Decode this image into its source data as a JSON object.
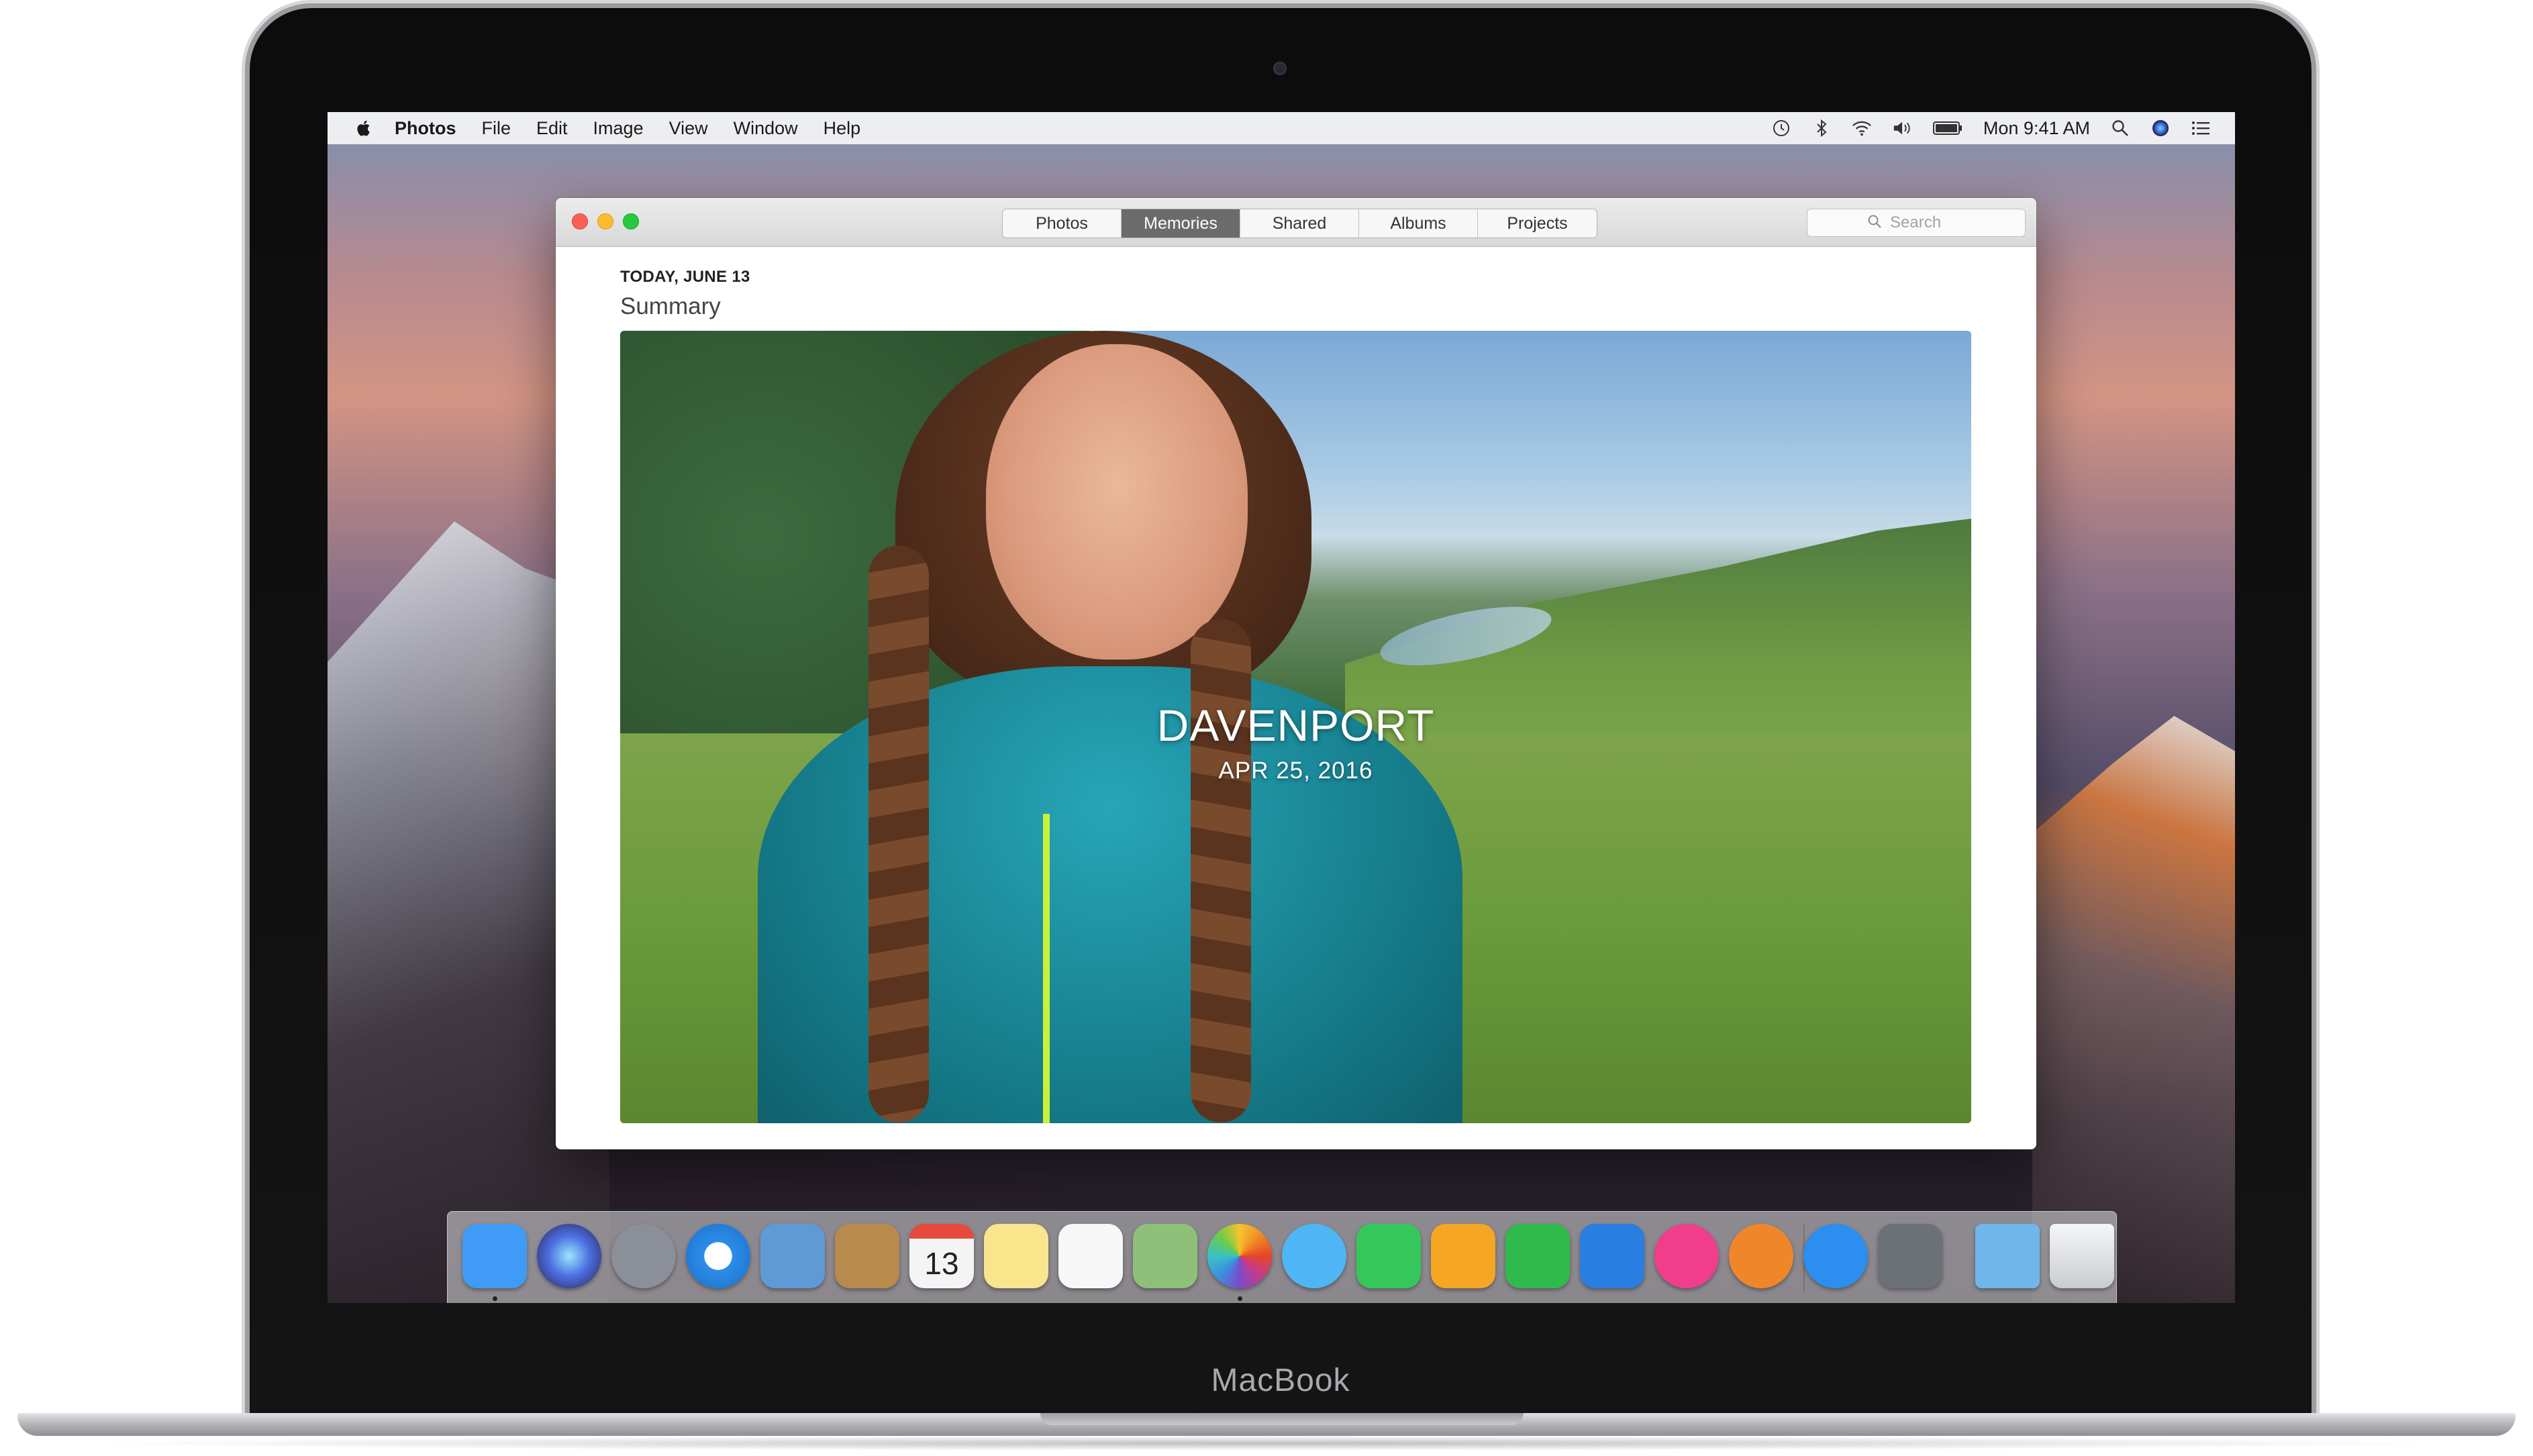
{
  "device": {
    "label": "MacBook"
  },
  "menubar": {
    "app_name": "Photos",
    "menus": [
      "File",
      "Edit",
      "Image",
      "View",
      "Window",
      "Help"
    ],
    "clock": "Mon 9:41 AM",
    "status_icons": [
      "time-machine-icon",
      "bluetooth-icon",
      "wifi-icon",
      "volume-icon",
      "battery-icon",
      "spotlight-icon",
      "siri-icon",
      "notification-center-icon"
    ]
  },
  "window": {
    "tabs": [
      "Photos",
      "Memories",
      "Shared",
      "Albums",
      "Projects"
    ],
    "active_tab": "Memories",
    "search": {
      "placeholder": "Search"
    },
    "date_label": "TODAY, JUNE 13",
    "section_title": "Summary",
    "memory": {
      "title": "DAVENPORT",
      "date": "APR 25, 2016"
    }
  },
  "dock": {
    "apps": [
      {
        "name": "finder-icon",
        "label": "",
        "color": "#3f9bf5",
        "running": true
      },
      {
        "name": "siri-icon",
        "label": "",
        "color": "#5a3a9c"
      },
      {
        "name": "launchpad-icon",
        "label": "",
        "color": "#8a8f98"
      },
      {
        "name": "safari-icon",
        "label": "",
        "color": "#2c8de8"
      },
      {
        "name": "mail-icon",
        "label": "",
        "color": "#5f9ad6"
      },
      {
        "name": "contacts-icon",
        "label": "",
        "color": "#b88a4b"
      },
      {
        "name": "calendar-icon",
        "label": "13",
        "color": "#f4f4f4"
      },
      {
        "name": "notes-icon",
        "label": "",
        "color": "#f8e58c"
      },
      {
        "name": "reminders-icon",
        "label": "",
        "color": "#f7f7f7"
      },
      {
        "name": "maps-icon",
        "label": "",
        "color": "#8fc07a"
      },
      {
        "name": "photos-icon",
        "label": "",
        "color": "#f5f5f5",
        "running": true
      },
      {
        "name": "messages-icon",
        "label": "",
        "color": "#4fb6f5"
      },
      {
        "name": "facetime-icon",
        "label": "",
        "color": "#35c759"
      },
      {
        "name": "pages-icon",
        "label": "",
        "color": "#f5a623"
      },
      {
        "name": "numbers-icon",
        "label": "",
        "color": "#30b94d"
      },
      {
        "name": "keynote-icon",
        "label": "",
        "color": "#2a7de1"
      },
      {
        "name": "itunes-icon",
        "label": "",
        "color": "#f03d8c"
      },
      {
        "name": "ibooks-icon",
        "label": "",
        "color": "#f0862a"
      },
      {
        "name": "app-store-icon",
        "label": "",
        "color": "#2b8ef0"
      },
      {
        "name": "system-preferences-icon",
        "label": "",
        "color": "#6c7077"
      },
      {
        "name": "downloads-folder-icon",
        "label": "",
        "color": "#6fb6ea"
      },
      {
        "name": "trash-icon",
        "label": "",
        "color": "#e5e7ea"
      }
    ]
  }
}
